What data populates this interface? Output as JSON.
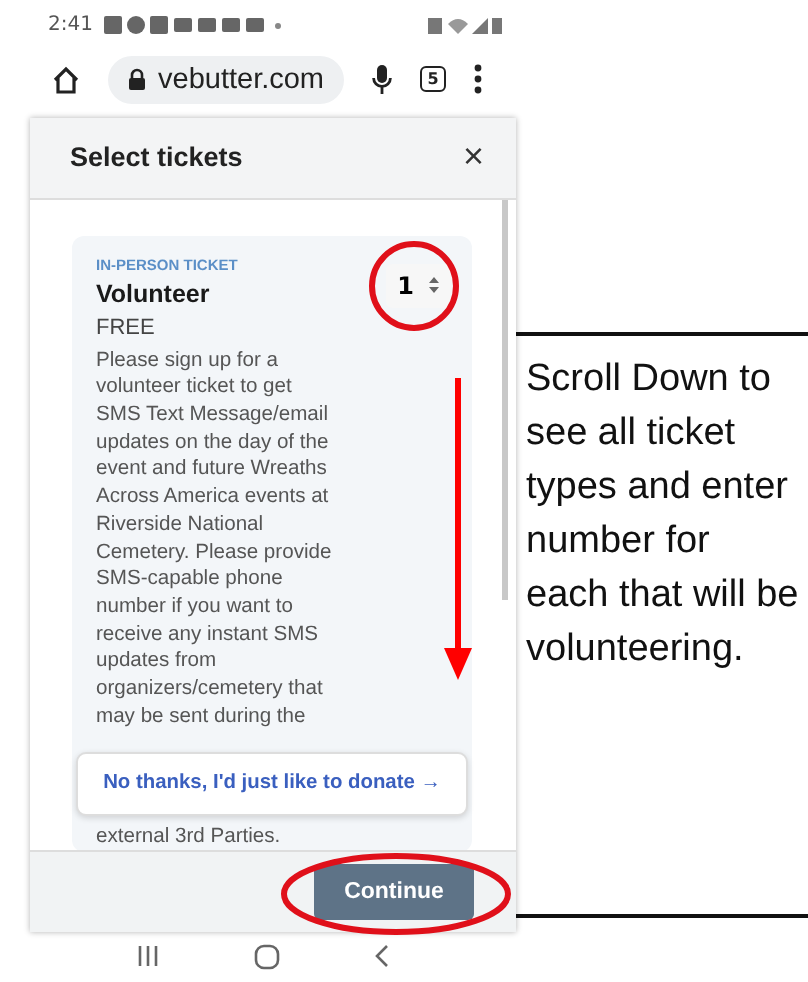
{
  "status_bar": {
    "time": "2:41"
  },
  "browser": {
    "url": "vebutter.com",
    "tab_count": "5"
  },
  "dialog": {
    "title": "Select tickets",
    "close": "×"
  },
  "tickets": [
    {
      "category": "IN-PERSON TICKET",
      "name": "Volunteer",
      "price": "FREE",
      "quantity": "1",
      "description_lines": [
        "Please sign up for a",
        "volunteer ticket to get",
        "SMS Text Message/email",
        "updates on the day of the",
        "event and future Wreaths",
        "Across America events at",
        "Riverside National",
        "Cemetery. Please provide",
        "SMS-capable phone",
        "number if you want to",
        "receive any instant SMS",
        "updates from",
        "organizers/cemetery that",
        "may be sent during the"
      ],
      "description_tail": "external 3rd Parties."
    }
  ],
  "donate_link": "No thanks, I'd just like to donate →",
  "continue_button": "Continue",
  "annotation": {
    "note": "Scroll Down to see all ticket types and enter number for each that will be volunteering."
  }
}
